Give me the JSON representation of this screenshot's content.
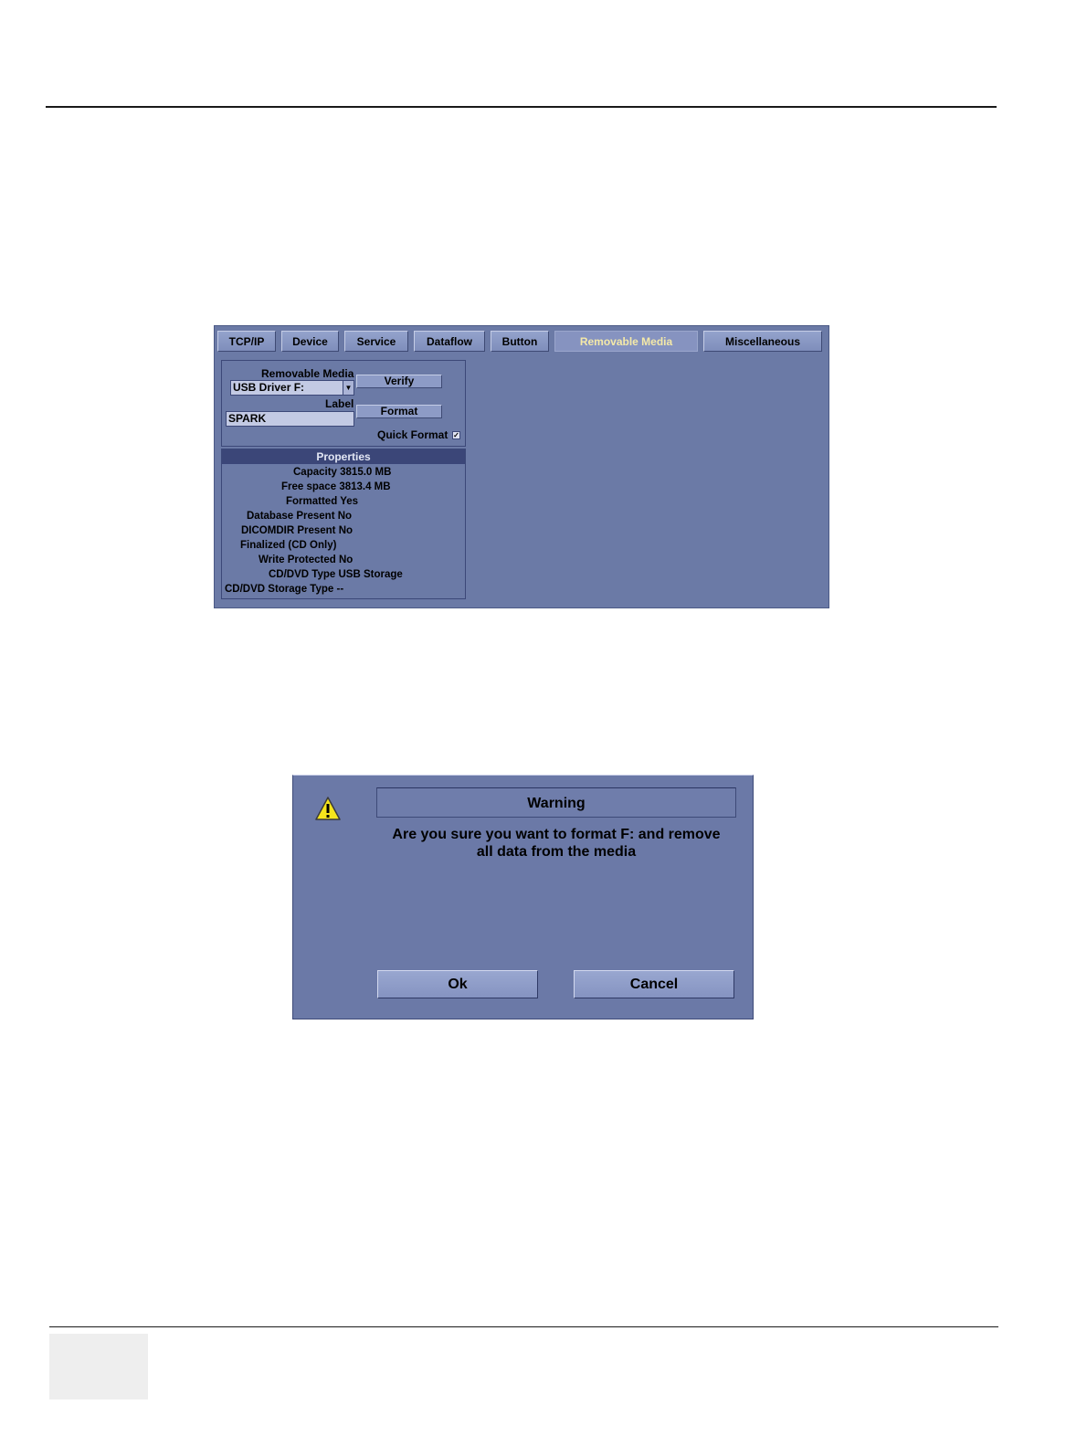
{
  "removable_media_screen": {
    "tabs": [
      {
        "label": "TCP/IP"
      },
      {
        "label": "Device"
      },
      {
        "label": "Service"
      },
      {
        "label": "Dataflow"
      },
      {
        "label": "Button"
      },
      {
        "label": "Removable Media",
        "active": true
      },
      {
        "label": "Miscellaneous"
      }
    ],
    "media_label": "Removable Media",
    "media_selected": "USB Driver F:",
    "label_label": "Label",
    "label_value": "SPARK",
    "verify_button": "Verify",
    "format_button": "Format",
    "quick_format_label": "Quick Format",
    "quick_format_checked": true,
    "properties": {
      "header": "Properties",
      "rows": [
        {
          "label": "Capacity",
          "value": "3815.0 MB"
        },
        {
          "label": "Free space",
          "value": "3813.4 MB"
        },
        {
          "label": "Formatted",
          "value": "Yes"
        },
        {
          "label": "Database Present",
          "value": "No"
        },
        {
          "label": "DICOMDIR Present",
          "value": "No"
        },
        {
          "label": "Finalized (CD Only)",
          "value": ""
        },
        {
          "label": "Write Protected",
          "value": "No"
        },
        {
          "label": "CD/DVD Type",
          "value": "USB Storage"
        },
        {
          "label": "CD/DVD Storage Type",
          "value": "--"
        }
      ]
    },
    "colors": {
      "panel": "#6b7aa6",
      "active_tab_text": "#f4e9a8",
      "header_bg": "#3b4678"
    }
  },
  "warning_dialog": {
    "icon": "warning-triangle-icon",
    "title": "Warning",
    "message_line1": "Are you sure you want to format F: and remove",
    "message_line2": "all data from the media",
    "ok_button": "Ok",
    "cancel_button": "Cancel"
  }
}
